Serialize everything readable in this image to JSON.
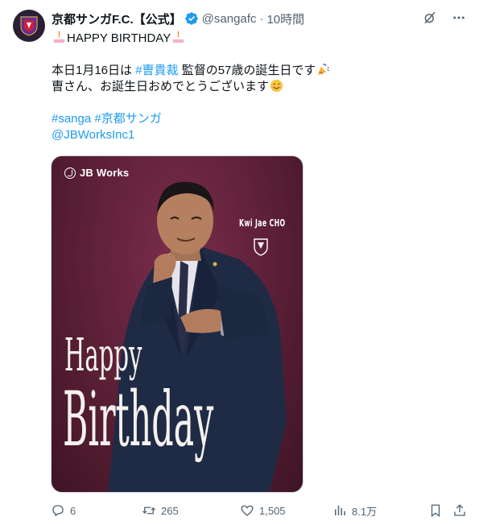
{
  "account": {
    "display_name": "京都サンガF.C.【公式】",
    "handle": "@sangafc",
    "separator": "·",
    "time": "10時間",
    "verified_color": "#1d9bf0"
  },
  "post": {
    "line1": "HAPPY BIRTHDAY",
    "line2_before": "本日1月16日は ",
    "line2_link": "#曺貴裁",
    "line2_after": " 監督の57歳の誕生日です",
    "line3": "曺さん、お誕生日おめでとうございます",
    "hashtag1": "#sanga",
    "hashtag2": "#京都サンガ",
    "mention": "@JBWorksInc1"
  },
  "media": {
    "logo_text": "JB Works",
    "coach_name": "Kwi Jae CHO",
    "happy": "Happy",
    "birthday": "Birthday",
    "background_color": "#5b1f36"
  },
  "actions": {
    "replies": "6",
    "reposts": "265",
    "likes": "1,505",
    "views": "8.1万"
  },
  "icons": {
    "top": [
      "grok-icon",
      "more-icon"
    ],
    "bar": [
      "reply-icon",
      "repost-icon",
      "like-icon",
      "views-icon",
      "bookmark-icon",
      "share-icon"
    ]
  },
  "colors": {
    "text": "#0f1419",
    "secondary": "#536471",
    "link": "#1d9bf0"
  }
}
